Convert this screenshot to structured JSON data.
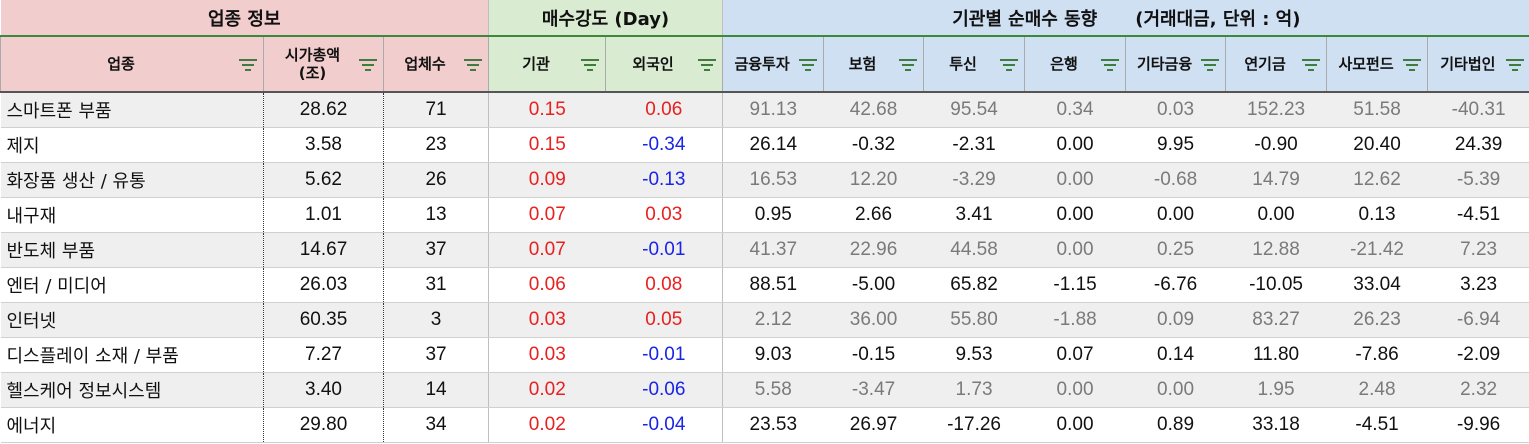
{
  "groups": {
    "industry_info": "업종 정보",
    "strength": "매수강도 (Day)",
    "institution_trend": "기관별 순매수 동향",
    "institution_unit": "(거래대금, 단위 : 억)"
  },
  "columns": {
    "industry": "업종",
    "market_cap_line1": "시가총액",
    "market_cap_line2": "(조)",
    "company_count": "업체수",
    "inst": "기관",
    "foreign": "외국인",
    "fin_invest": "금융투자",
    "insurance": "보험",
    "trust": "투신",
    "bank": "은행",
    "other_fin": "기타금융",
    "pension": "연기금",
    "private_fund": "사모펀드",
    "other_corp": "기타법인"
  },
  "colors": {
    "positive": "#e8201f",
    "negative": "#1a24e6",
    "muted": "#7a7a7a"
  },
  "rows": [
    {
      "name": "스마트폰 부품",
      "cap": "28.62",
      "count": "71",
      "inst": "0.15",
      "foreign": "0.06",
      "fin": "91.13",
      "ins": "42.68",
      "trust": "95.54",
      "bank": "0.34",
      "ofin": "0.03",
      "pension": "152.23",
      "pfund": "51.58",
      "ocorp": "-40.31"
    },
    {
      "name": "제지",
      "cap": "3.58",
      "count": "23",
      "inst": "0.15",
      "foreign": "-0.34",
      "fin": "26.14",
      "ins": "-0.32",
      "trust": "-2.31",
      "bank": "0.00",
      "ofin": "9.95",
      "pension": "-0.90",
      "pfund": "20.40",
      "ocorp": "24.39"
    },
    {
      "name": "화장품 생산 / 유통",
      "cap": "5.62",
      "count": "26",
      "inst": "0.09",
      "foreign": "-0.13",
      "fin": "16.53",
      "ins": "12.20",
      "trust": "-3.29",
      "bank": "0.00",
      "ofin": "-0.68",
      "pension": "14.79",
      "pfund": "12.62",
      "ocorp": "-5.39"
    },
    {
      "name": "내구재",
      "cap": "1.01",
      "count": "13",
      "inst": "0.07",
      "foreign": "0.03",
      "fin": "0.95",
      "ins": "2.66",
      "trust": "3.41",
      "bank": "0.00",
      "ofin": "0.00",
      "pension": "0.00",
      "pfund": "0.13",
      "ocorp": "-4.51"
    },
    {
      "name": "반도체 부품",
      "cap": "14.67",
      "count": "37",
      "inst": "0.07",
      "foreign": "-0.01",
      "fin": "41.37",
      "ins": "22.96",
      "trust": "44.58",
      "bank": "0.00",
      "ofin": "0.25",
      "pension": "12.88",
      "pfund": "-21.42",
      "ocorp": "7.23"
    },
    {
      "name": "엔터 / 미디어",
      "cap": "26.03",
      "count": "31",
      "inst": "0.06",
      "foreign": "0.08",
      "fin": "88.51",
      "ins": "-5.00",
      "trust": "65.82",
      "bank": "-1.15",
      "ofin": "-6.76",
      "pension": "-10.05",
      "pfund": "33.04",
      "ocorp": "3.23"
    },
    {
      "name": "인터넷",
      "cap": "60.35",
      "count": "3",
      "inst": "0.03",
      "foreign": "0.05",
      "fin": "2.12",
      "ins": "36.00",
      "trust": "55.80",
      "bank": "-1.88",
      "ofin": "0.09",
      "pension": "83.27",
      "pfund": "26.23",
      "ocorp": "-6.94"
    },
    {
      "name": "디스플레이 소재 / 부품",
      "cap": "7.27",
      "count": "37",
      "inst": "0.03",
      "foreign": "-0.01",
      "fin": "9.03",
      "ins": "-0.15",
      "trust": "9.53",
      "bank": "0.07",
      "ofin": "0.14",
      "pension": "11.80",
      "pfund": "-7.86",
      "ocorp": "-2.09"
    },
    {
      "name": "헬스케어 정보시스템",
      "cap": "3.40",
      "count": "14",
      "inst": "0.02",
      "foreign": "-0.06",
      "fin": "5.58",
      "ins": "-3.47",
      "trust": "1.73",
      "bank": "0.00",
      "ofin": "0.00",
      "pension": "1.95",
      "pfund": "2.48",
      "ocorp": "2.32"
    },
    {
      "name": "에너지",
      "cap": "29.80",
      "count": "34",
      "inst": "0.02",
      "foreign": "-0.04",
      "fin": "23.53",
      "ins": "26.97",
      "trust": "-17.26",
      "bank": "0.00",
      "ofin": "0.89",
      "pension": "33.18",
      "pfund": "-4.51",
      "ocorp": "-9.96"
    }
  ]
}
